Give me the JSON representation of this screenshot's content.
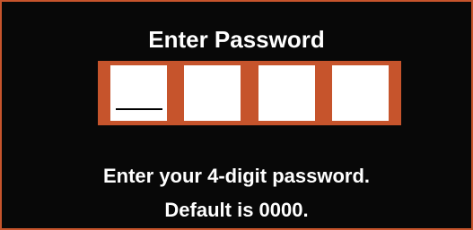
{
  "dialog": {
    "title": "Enter Password",
    "pin_digits": [
      "",
      "",
      "",
      ""
    ],
    "instruction_line1": "Enter your 4-digit password.",
    "instruction_line2": "Default is 0000.",
    "active_digit_index": 0
  },
  "colors": {
    "background": "#080808",
    "accent": "#c6542c",
    "text": "#ffffff",
    "digit_field": "#ffffff"
  }
}
